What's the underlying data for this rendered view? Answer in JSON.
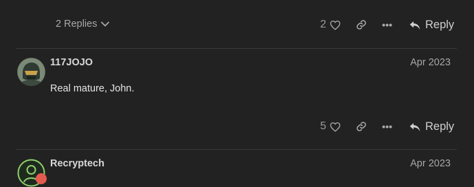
{
  "top_post": {
    "replies_toggle": "2 Replies",
    "like_count": "2",
    "reply_label": "Reply"
  },
  "post_117jojo": {
    "username": "117JOJO",
    "date": "Apr 2023",
    "body": "Real mature, John.",
    "like_count": "5",
    "reply_label": "Reply"
  },
  "post_recryptech": {
    "username": "Recryptech",
    "date": "Apr 2023"
  },
  "colors": {
    "background": "#222222",
    "muted_text": "#a8a8a8",
    "divider": "#3a3a3a",
    "badge": "#e45a4f"
  }
}
